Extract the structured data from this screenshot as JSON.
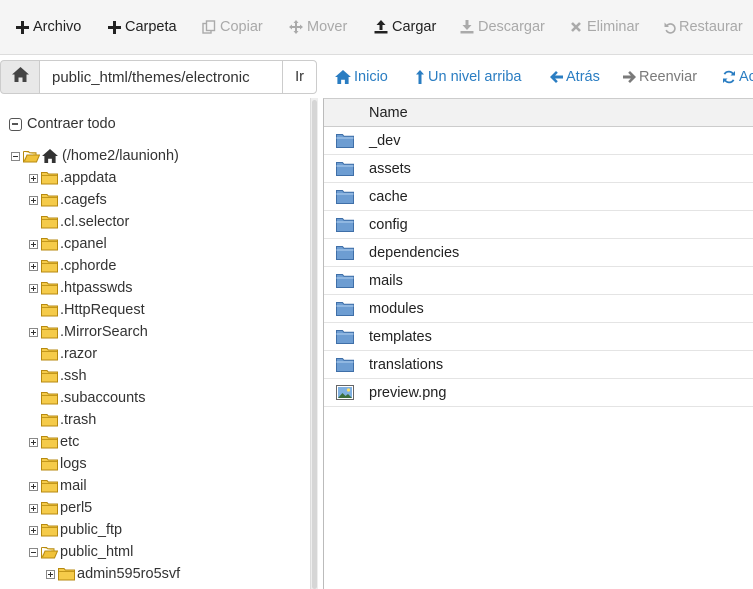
{
  "toolbar": {
    "archivo": "Archivo",
    "carpeta": "Carpeta",
    "copiar": "Copiar",
    "mover": "Mover",
    "cargar": "Cargar",
    "descargar": "Descargar",
    "eliminar": "Eliminar",
    "restaurar": "Restaurar"
  },
  "pathbar": {
    "path": "public_html/themes/electronic",
    "go": "Ir"
  },
  "nav": {
    "inicio": "Inicio",
    "up": "Un nivel arriba",
    "back": "Atrás",
    "forward": "Reenviar",
    "reload": "Ac"
  },
  "tree": {
    "collapse_all": "Contraer todo",
    "root": "(/home2/launionh)",
    "items": [
      ".appdata",
      ".cagefs",
      ".cl.selector",
      ".cpanel",
      ".cphorde",
      ".htpasswds",
      ".HttpRequest",
      ".MirrorSearch",
      ".razor",
      ".ssh",
      ".subaccounts",
      ".trash",
      "etc",
      "logs",
      "mail",
      "perl5",
      "public_ftp",
      "public_html"
    ],
    "sub_items": [
      "admin595ro5svf"
    ]
  },
  "files": {
    "header": "Name",
    "rows": [
      "_dev",
      "assets",
      "cache",
      "config",
      "dependencies",
      "mails",
      "modules",
      "templates",
      "translations",
      "preview.png"
    ]
  },
  "colors": {
    "link": "#2a7dc2",
    "folder_tree": "#f0c23a",
    "folder_file": "#5b8fc9"
  }
}
